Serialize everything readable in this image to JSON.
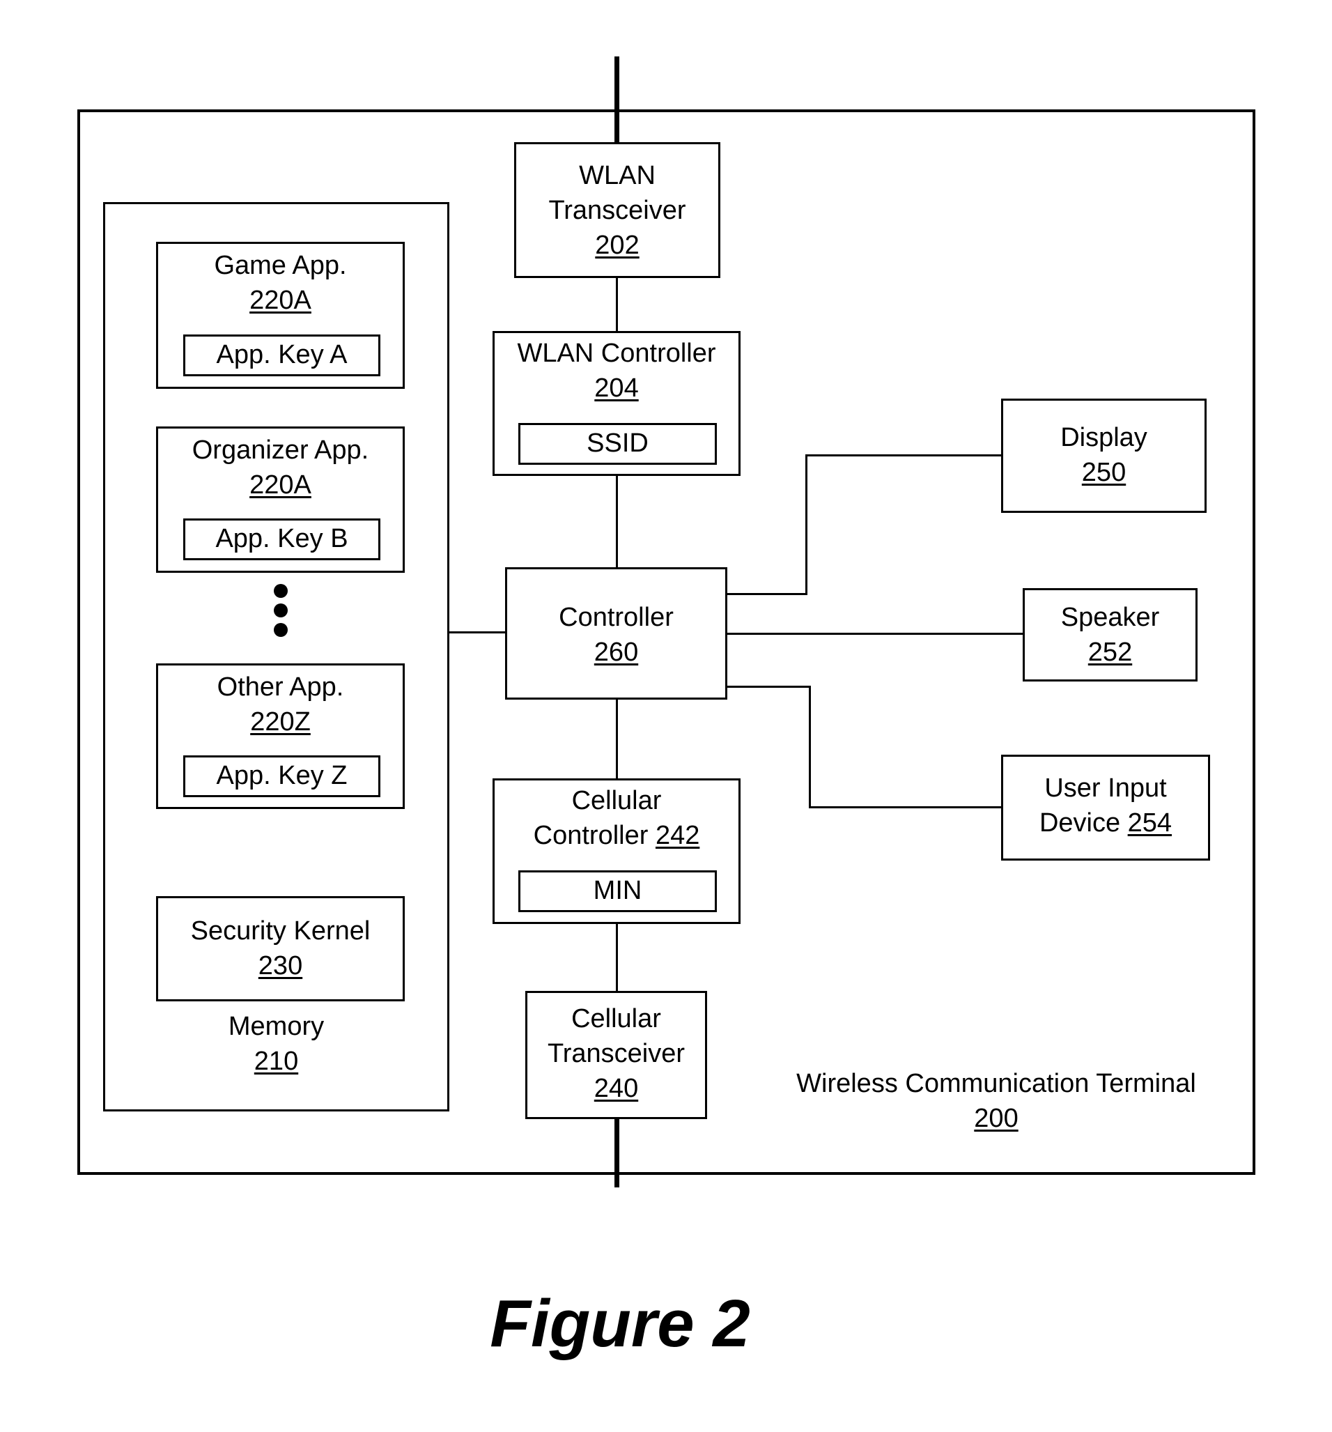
{
  "figure_title": "Figure 2",
  "terminal": {
    "name": "Wireless Communication Terminal",
    "ref": "200"
  },
  "memory": {
    "name": "Memory",
    "ref": "210",
    "apps": [
      {
        "name": "Game App.",
        "ref": "220A",
        "key": "App. Key A"
      },
      {
        "name": "Organizer App.",
        "ref": "220A",
        "key": "App. Key B"
      },
      {
        "name": "Other App.",
        "ref": "220Z",
        "key": "App. Key Z"
      }
    ],
    "ellipsis": "⋮",
    "security_kernel": {
      "name": "Security Kernel",
      "ref": "230"
    }
  },
  "wlan_transceiver": {
    "line1": "WLAN",
    "line2": "Transceiver",
    "ref": "202"
  },
  "wlan_controller": {
    "name": "WLAN Controller",
    "ref": "204",
    "field": "SSID"
  },
  "controller": {
    "name": "Controller",
    "ref": "260"
  },
  "cellular_controller": {
    "line1": "Cellular",
    "line2": "Controller",
    "ref": "242",
    "field": "MIN"
  },
  "cellular_transceiver": {
    "line1": "Cellular",
    "line2": "Transceiver",
    "ref": "240"
  },
  "display": {
    "name": "Display",
    "ref": "250"
  },
  "speaker": {
    "name": "Speaker",
    "ref": "252"
  },
  "user_input": {
    "line1": "User Input",
    "line2": "Device",
    "ref": "254"
  }
}
